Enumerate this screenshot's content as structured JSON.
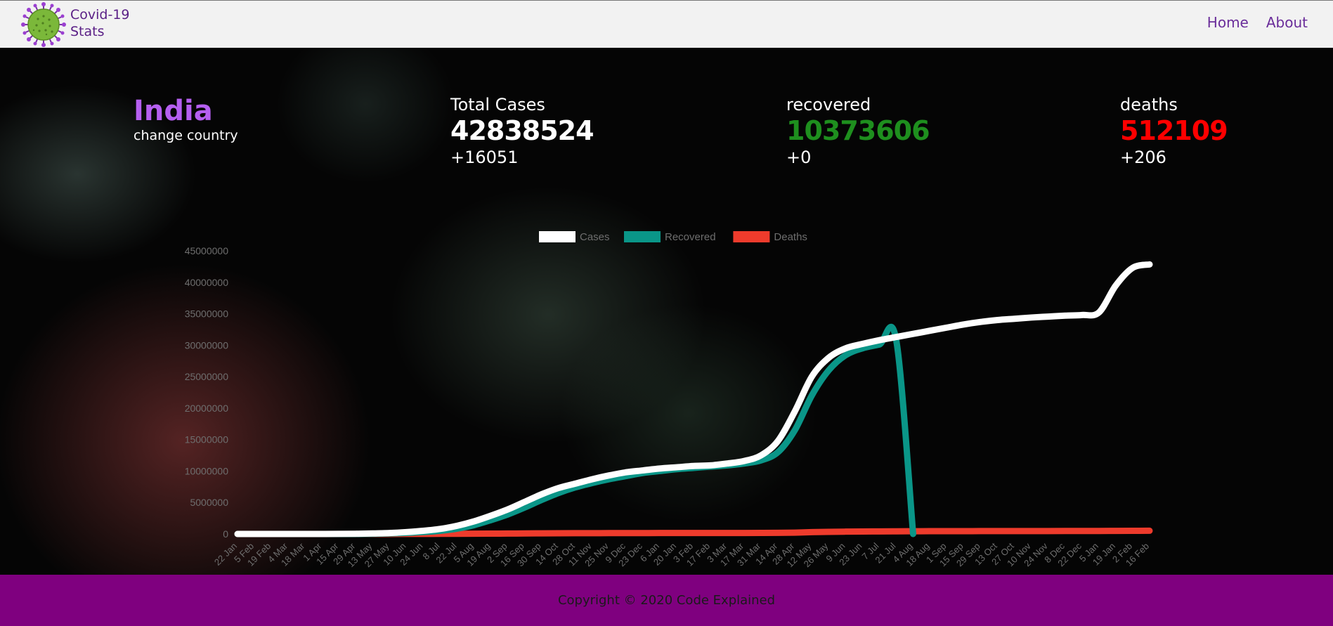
{
  "brand": {
    "line1": "Covid-19",
    "line2": "Stats"
  },
  "nav": {
    "home": "Home",
    "about": "About"
  },
  "country": {
    "name": "India",
    "change_label": "change country"
  },
  "stats": {
    "total": {
      "label": "Total Cases",
      "value": "42838524",
      "new": "+16051",
      "color": "#ffffff"
    },
    "recovered": {
      "label": "recovered",
      "value": "10373606",
      "new": "+0",
      "color": "#1e8f1e"
    },
    "deaths": {
      "label": "deaths",
      "value": "512109",
      "new": "+206",
      "color": "#ff0000"
    }
  },
  "footer": {
    "text": "Copyright © 2020 Code Explained"
  },
  "chart_data": {
    "type": "line",
    "ylim": [
      0,
      45000000
    ],
    "yticks": [
      "45000000",
      "40000000",
      "35000000",
      "30000000",
      "25000000",
      "20000000",
      "15000000",
      "10000000",
      "5000000",
      "0"
    ],
    "x": [
      "22 Jan",
      "5 Feb",
      "19 Feb",
      "4 Mar",
      "18 Mar",
      "1 Apr",
      "15 Apr",
      "29 Apr",
      "13 May",
      "27 May",
      "10 Jun",
      "24 Jun",
      "8 Jul",
      "22 Jul",
      "5 Aug",
      "19 Aug",
      "2 Sep",
      "16 Sep",
      "30 Sep",
      "14 Oct",
      "28 Oct",
      "11 Nov",
      "25 Nov",
      "9 Dec",
      "23 Dec",
      "6 Jan",
      "20 Jan",
      "3 Feb",
      "17 Feb",
      "3 Mar",
      "17 Mar",
      "31 Mar",
      "14 Apr",
      "28 Apr",
      "12 May",
      "26 May",
      "9 Jun",
      "23 Jun",
      "7 Jul",
      "21 Jul",
      "4 Aug",
      "18 Aug",
      "1 Sep",
      "15 Sep",
      "29 Sep",
      "13 Oct",
      "27 Oct",
      "10 Nov",
      "24 Nov",
      "8 Dec",
      "22 Dec",
      "5 Jan",
      "19 Jan",
      "2 Feb",
      "16 Feb"
    ],
    "legend_position": "top",
    "series": [
      {
        "name": "Cases",
        "color": "#ffffff",
        "values": [
          0,
          0,
          0,
          0,
          0,
          1000,
          10000,
          30000,
          80000,
          160000,
          300000,
          500000,
          800000,
          1300000,
          2000000,
          2900000,
          3900000,
          5100000,
          6300000,
          7300000,
          8000000,
          8700000,
          9300000,
          9800000,
          10100000,
          10400000,
          10600000,
          10800000,
          10900000,
          11200000,
          11600000,
          12500000,
          14800000,
          19500000,
          25000000,
          28000000,
          29500000,
          30200000,
          30800000,
          31300000,
          31800000,
          32300000,
          32800000,
          33300000,
          33700000,
          34000000,
          34200000,
          34400000,
          34550000,
          34700000,
          34800000,
          35200000,
          39500000,
          42300000,
          42838524
        ]
      },
      {
        "name": "Recovered",
        "color": "#0a9688",
        "values": [
          0,
          0,
          0,
          0,
          0,
          0,
          1000,
          5000,
          30000,
          80000,
          170000,
          300000,
          500000,
          850000,
          1400000,
          2200000,
          3100000,
          4200000,
          5400000,
          6500000,
          7400000,
          8100000,
          8700000,
          9200000,
          9700000,
          10000000,
          10300000,
          10500000,
          10700000,
          10900000,
          11200000,
          11700000,
          13000000,
          16500000,
          22000000,
          26000000,
          28400000,
          29500000,
          30100000,
          30800000,
          0
        ]
      },
      {
        "name": "Deaths",
        "color": "#ee3b2c",
        "values": [
          0,
          0,
          0,
          0,
          0,
          0,
          400,
          1000,
          2500,
          4500,
          8500,
          15000,
          22000,
          30000,
          40000,
          53000,
          68000,
          83000,
          98000,
          110000,
          120000,
          128000,
          135000,
          141000,
          145000,
          149000,
          152000,
          155000,
          157000,
          158000,
          160000,
          163000,
          175000,
          210000,
          290000,
          340000,
          370000,
          395000,
          405000,
          420000,
          430000,
          440000,
          445000,
          450000,
          455000,
          460000,
          462000,
          464000,
          466000,
          468000,
          470000,
          475000,
          490000,
          505000,
          512109
        ]
      }
    ]
  }
}
